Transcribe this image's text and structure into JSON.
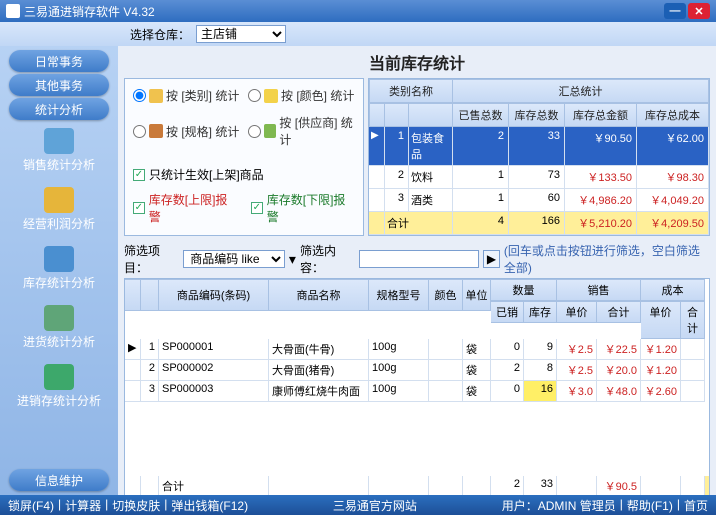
{
  "window": {
    "title": "三易通进销存软件 V4.32"
  },
  "topbar": {
    "label": "选择仓库：",
    "options": [
      "主店铺"
    ],
    "selected": "主店铺"
  },
  "page_title": "当前库存统计",
  "sidebar": {
    "pills": [
      "日常事务",
      "其他事务",
      "统计分析"
    ],
    "items": [
      {
        "label": "销售统计分析",
        "color": "#5fa3d8"
      },
      {
        "label": "经营利润分析",
        "color": "#e6b53a"
      },
      {
        "label": "库存统计分析",
        "color": "#4a8fd0"
      },
      {
        "label": "进货统计分析",
        "color": "#5fa578"
      },
      {
        "label": "进销存统计分析",
        "color": "#3da86b"
      }
    ],
    "bottom_pill": "信息维护"
  },
  "stat_opts": {
    "r1": "按 [类别] 统计",
    "r2": "按 [颜色] 统计",
    "r3": "按 [规格] 统计",
    "r4": "按 [供应商] 统计",
    "c1": "只统计生效[上架]商品",
    "c2": "库存数[上限]报警",
    "c3": "库存数[下限]报警"
  },
  "top_table": {
    "headA": "类别名称",
    "headB": "汇总统计",
    "cols": [
      "已售总数",
      "库存总数",
      "库存总金额",
      "库存总成本"
    ],
    "rows": [
      {
        "n": "1",
        "name": "包装食品",
        "sold": "2",
        "stock": "33",
        "amt": "￥90.50",
        "cost": "￥62.00"
      },
      {
        "n": "2",
        "name": "饮料",
        "sold": "1",
        "stock": "73",
        "amt": "￥133.50",
        "cost": "￥98.30"
      },
      {
        "n": "3",
        "name": "酒类",
        "sold": "1",
        "stock": "60",
        "amt": "￥4,986.20",
        "cost": "￥4,049.20"
      }
    ],
    "total": {
      "label": "合计",
      "sold": "4",
      "stock": "166",
      "amt": "￥5,210.20",
      "cost": "￥4,209.50"
    }
  },
  "filter": {
    "l1": "筛选项目：",
    "sel": "商品编码 like",
    "l2": "筛选内容：",
    "hint": "(回车或点击按钮进行筛选，空白筛选全部)"
  },
  "bottom_table": {
    "h": {
      "code": "商品编码(条码)",
      "name": "商品名称",
      "spec": "规格型号",
      "color": "颜色",
      "unit": "单位",
      "qty": "数量",
      "sold": "已销",
      "stock": "库存",
      "sale": "销售",
      "price": "单价",
      "sum": "合计",
      "cost": "成本"
    },
    "rows": [
      {
        "n": "1",
        "code": "SP000001",
        "name": "大骨面(牛骨)",
        "spec": "100g",
        "color": "",
        "unit": "袋",
        "sold": "0",
        "stock": "9",
        "price": "￥2.5",
        "sum": "￥22.5",
        "cprice": "￥1.20",
        "csum": ""
      },
      {
        "n": "2",
        "code": "SP000002",
        "name": "大骨面(猪骨)",
        "spec": "100g",
        "color": "",
        "unit": "袋",
        "sold": "2",
        "stock": "8",
        "price": "￥2.5",
        "sum": "￥20.0",
        "cprice": "￥1.20",
        "csum": ""
      },
      {
        "n": "3",
        "code": "SP000003",
        "name": "康师傅红烧牛肉面",
        "spec": "100g",
        "color": "",
        "unit": "袋",
        "sold": "0",
        "stock": "16",
        "price": "￥3.0",
        "sum": "￥48.0",
        "cprice": "￥2.60",
        "csum": ""
      }
    ],
    "total": {
      "label": "合计",
      "sold": "2",
      "stock": "33",
      "sum": "￥90.5"
    }
  },
  "status": {
    "left": [
      "锁屏(F4)",
      "计算器",
      "切换皮肤",
      "弹出钱箱(F12)"
    ],
    "center": "三易通官方网站",
    "right": [
      "用户：ADMIN 管理员",
      "帮助(F1)",
      "首页"
    ]
  }
}
